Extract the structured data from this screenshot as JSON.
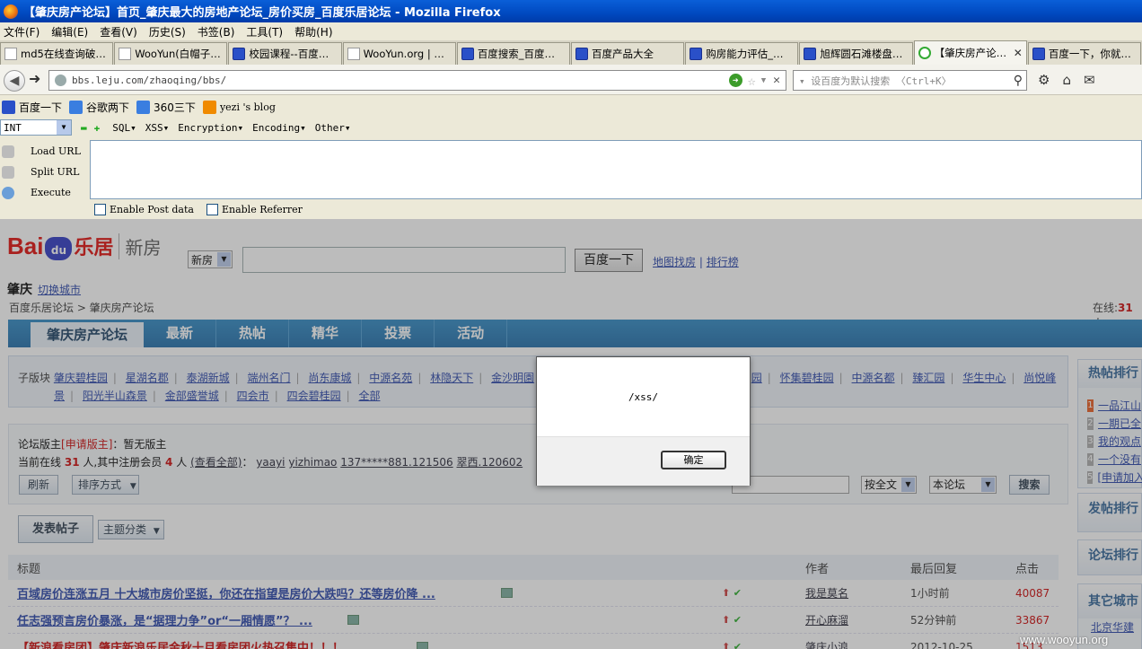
{
  "window": {
    "title": "【肇庆房产论坛】首页_肇庆最大的房地产论坛_房价买房_百度乐居论坛 - Mozilla Firefox"
  },
  "menu": [
    "文件(F)",
    "编辑(E)",
    "查看(V)",
    "历史(S)",
    "书签(B)",
    "工具(T)",
    "帮助(H)"
  ],
  "tabs": [
    {
      "label": "md5在线查询破…",
      "icon": "grid-icon"
    },
    {
      "label": "WooYun(白帽子…",
      "icon": "page-icon"
    },
    {
      "label": "校园课程--百度…",
      "icon": "baidu-paw-icon"
    },
    {
      "label": "WooYun.org | …",
      "icon": "page-icon"
    },
    {
      "label": "百度搜索_百度…",
      "icon": "baidu-paw-icon"
    },
    {
      "label": "百度产品大全",
      "icon": "baidu-paw-icon"
    },
    {
      "label": "购房能力评估_…",
      "icon": "baidu-paw-icon"
    },
    {
      "label": "旭辉圆石滩楼盘…",
      "icon": "baidu-paw-icon"
    },
    {
      "label": "【肇庆房产论…",
      "icon": "loading-icon",
      "active": true,
      "close": "✕"
    },
    {
      "label": "百度一下，你就…",
      "icon": "baidu-paw-icon"
    }
  ],
  "nav": {
    "url": "bbs.leju.com/zhaoqing/bbs/",
    "search_placeholder": "▾ 设百度为默认搜索 〈Ctrl+K〉"
  },
  "bookmarks": [
    {
      "label": "百度一下",
      "color": "#2a50c8"
    },
    {
      "label": "谷歌两下",
      "color": "#3a7ee0"
    },
    {
      "label": "360三下",
      "color": "#3a7ee0"
    },
    {
      "label": "yezi 's blog",
      "color": "#f08a00"
    }
  ],
  "hackbar": {
    "select_value": "INT",
    "menus": [
      "SQL▾",
      "XSS▾",
      "Encryption▾",
      "Encoding▾",
      "Other▾"
    ],
    "buttons": [
      "Load URL",
      "Split URL",
      "Execute"
    ],
    "checks": [
      "Enable Post data",
      "Enable Referrer"
    ]
  },
  "page": {
    "logo": {
      "bai": "Bai",
      "du": "du",
      "leju": "乐居",
      "xinfang": "新房"
    },
    "category_select": "新房",
    "search_button": "百度一下",
    "links": [
      "地图找房",
      "排行榜"
    ],
    "city": "肇庆",
    "switch_city": "切换城市",
    "breadcrumb": "百度乐居论坛 > 肇庆房产论坛",
    "online_label": "在线:",
    "online_count": "31",
    "online_suffix": "人",
    "nav_tabs": [
      "肇庆房产论坛",
      "最新",
      "热帖",
      "精华",
      "投票",
      "活动"
    ],
    "sub_label": "子版块",
    "sub_row1": [
      "肇庆碧桂园",
      "星湖名郡",
      "泰湖新城",
      "端州名门",
      "尚东康城",
      "中源名苑",
      "林隐天下",
      "金沙明園"
    ],
    "sub_row1_right": [
      "园",
      "怀集碧桂园",
      "中源名都",
      "臻汇园",
      "华生中心",
      "尚悦峰"
    ],
    "sub_row2": [
      "景",
      "阳光半山森景",
      "金部盛誉城",
      "四会市",
      "四会碧桂园",
      "全部"
    ],
    "moderator_label": "论坛版主",
    "moderator_apply": "[申请版主]",
    "moderator_none": "：暂无版主",
    "online_now": "当前在线",
    "online_now_n": "31",
    "online_now_mid": "人,其中注册会员",
    "online_members": "4",
    "online_now_tail": "人",
    "view_all": "(查看全部)",
    "members": [
      "yaayi",
      "yizhimao",
      "137*****881.121506",
      "翠西.120602"
    ],
    "refresh": "刷新",
    "sort": "排序方式",
    "search_scope": "按全文",
    "search_area": "本论坛",
    "search_btn": "搜索",
    "post_btn": "发表帖子",
    "topic_cat": "主题分类",
    "list_head": {
      "title": "标题",
      "author": "作者",
      "last": "最后回复",
      "hits": "点击"
    },
    "rows": [
      {
        "title": "百域房价连涨五月 十大城市房价坚挺，你还在指望是房价大跌吗？还等房价降 ...",
        "author": "我是莫名",
        "last": "1小时前",
        "hits": "40087",
        "red": false
      },
      {
        "title": "任志强预言房价暴涨，是“据理力争”or“一厢情愿”？ ...",
        "author": "开心麻溜",
        "last": "52分钟前",
        "hits": "33867",
        "red": false
      },
      {
        "title": "【新浪看房团】肇庆新浪乐居金秋十月看房团火热召集中！！！",
        "author": "肇庆小浪",
        "last": "2012-10-25",
        "hits": "1513",
        "red": true
      }
    ],
    "side_hot": "热帖排行",
    "side_hot_items": [
      "一品江山",
      "一期已全",
      "我的观点",
      "一个没有",
      "[申请加入"
    ],
    "side_post": "发帖排行",
    "side_forum": "论坛排行",
    "side_other": "其它城市",
    "side_other_item": "北京华建"
  },
  "dialog": {
    "message": "/xss/",
    "ok": "确定"
  },
  "watermark": "www.wooyun.org"
}
